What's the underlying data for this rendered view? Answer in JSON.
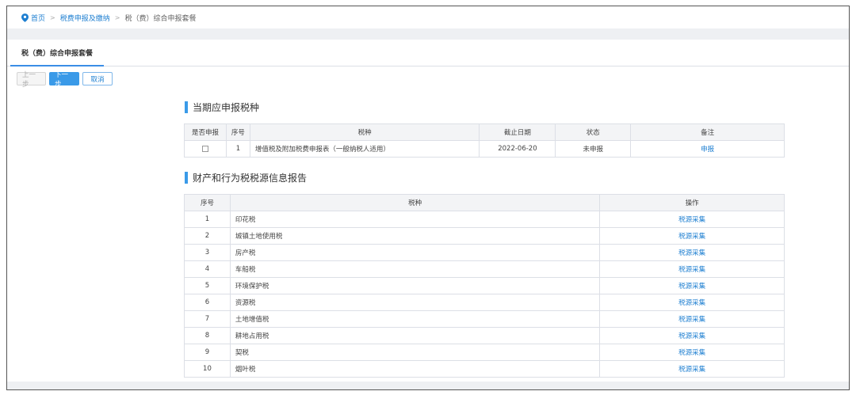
{
  "breadcrumb": {
    "home": "首页",
    "level1": "税费申报及缴纳",
    "current": "税（费）综合申报套餐"
  },
  "tab": {
    "label": "税（费）综合申报套餐"
  },
  "buttons": {
    "prev": "上一步",
    "next": "下一步",
    "cancel": "取消"
  },
  "section1": {
    "title": "当期应申报税种",
    "headers": [
      "是否申报",
      "序号",
      "税种",
      "截止日期",
      "状态",
      "备注"
    ],
    "rows": [
      {
        "seq": "1",
        "tax": "增值税及附加税费申报表（一般纳税人适用）",
        "deadline": "2022-06-20",
        "status": "未申报",
        "action": "申报"
      }
    ]
  },
  "section2": {
    "title": "财产和行为税税源信息报告",
    "headers": [
      "序号",
      "税种",
      "操作"
    ],
    "rows": [
      {
        "seq": "1",
        "tax": "印花税",
        "action": "税源采集"
      },
      {
        "seq": "2",
        "tax": "城镇土地使用税",
        "action": "税源采集"
      },
      {
        "seq": "3",
        "tax": "房产税",
        "action": "税源采集"
      },
      {
        "seq": "4",
        "tax": "车船税",
        "action": "税源采集"
      },
      {
        "seq": "5",
        "tax": "环境保护税",
        "action": "税源采集"
      },
      {
        "seq": "6",
        "tax": "资源税",
        "action": "税源采集"
      },
      {
        "seq": "7",
        "tax": "土地增值税",
        "action": "税源采集"
      },
      {
        "seq": "8",
        "tax": "耕地占用税",
        "action": "税源采集"
      },
      {
        "seq": "9",
        "tax": "契税",
        "action": "税源采集"
      },
      {
        "seq": "10",
        "tax": "烟叶税",
        "action": "税源采集"
      }
    ]
  },
  "colors": {
    "accent": "#3a9ae8",
    "link": "#1e7fd1"
  }
}
